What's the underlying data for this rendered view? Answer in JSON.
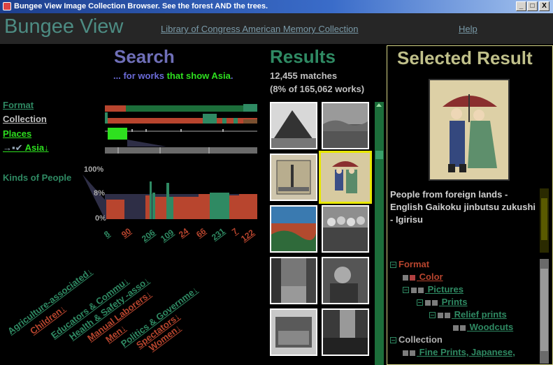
{
  "window": {
    "title": "Bungee View Image Collection Browser.  See the forest AND the trees.",
    "minimize": "_",
    "maximize": "□",
    "close": "X"
  },
  "header": {
    "app_name": "Bungee View",
    "collection_link": "Library of Congress American Memory Collection",
    "help": "Help"
  },
  "search": {
    "heading": "Search",
    "prefix": "... for works ",
    "highlight": "that show Asia",
    "suffix": ".",
    "facets": {
      "format": "Format",
      "collection": "Collection",
      "places": "Places",
      "asia": "Asia"
    },
    "asia_path_glyphs": "→▪✔",
    "kinds_label": "Kinds of People",
    "axis_labels": [
      "100%",
      "8%",
      "0%"
    ],
    "counts": [
      "8",
      "90",
      "206",
      "109",
      "24",
      "66",
      "231",
      "7",
      "122"
    ],
    "kinds": [
      {
        "label": "Agriculture-associated",
        "color": "#2f8a63"
      },
      {
        "label": "Children",
        "color": "#b8452e"
      },
      {
        "label": "Educators & Commu",
        "color": "#2f8a63"
      },
      {
        "label": "Health & Safety -asso",
        "color": "#2f8a63"
      },
      {
        "label": "Manual Laborers",
        "color": "#b8452e"
      },
      {
        "label": "Men",
        "color": "#b8452e"
      },
      {
        "label": "Politics & Governme",
        "color": "#2f8a63"
      },
      {
        "label": "Spectators",
        "color": "#b8452e"
      },
      {
        "label": "Women",
        "color": "#b8452e"
      }
    ]
  },
  "results": {
    "heading": "Results",
    "matches": "12,455 matches",
    "fraction": "(8%  of 165,062 works)"
  },
  "selected": {
    "heading": "Selected Result",
    "description": "People from foreign lands - English Gaikoku jinbutsu zukushi - Igirisu",
    "tree": [
      {
        "label": "Format",
        "color": "#b8452e"
      },
      {
        "label": "Color",
        "color": "#b8452e"
      },
      {
        "label": "Pictures",
        "color": "#2f8a63"
      },
      {
        "label": "Prints",
        "color": "#2f8a63"
      },
      {
        "label": "Relief prints",
        "color": "#2f8a63"
      },
      {
        "label": "Woodcuts",
        "color": "#2f8a63"
      },
      {
        "label": "Collection",
        "color": "#b0b0b0"
      },
      {
        "label": "Fine Prints, Japanese,",
        "color": "#2f8a63"
      }
    ]
  },
  "colors": {
    "accent_green": "#2f8a63",
    "highlight_green": "#2ee01f",
    "negative_red": "#b8452e",
    "selection_yellow": "#e8e800"
  },
  "icons": [
    "app-icon",
    "arrow-right-icon",
    "checkmark-icon",
    "down-arrow-icon",
    "tree-toggle-icon"
  ]
}
